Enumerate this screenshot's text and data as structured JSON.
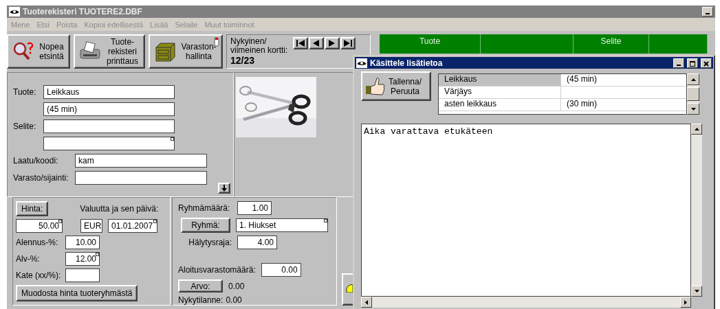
{
  "window": {
    "title": "Tuoterekisteri TUOTERE2.DBF"
  },
  "menu": [
    "Mene",
    "Etsi",
    "Poista",
    "Kopioi edellisestä",
    "Lisää",
    "Selaile",
    "Muut toiminnot"
  ],
  "toolbar": [
    {
      "kind": "search",
      "label": "Nopea\netsintä"
    },
    {
      "kind": "print",
      "label": "Tuote-\nrekisteri\nprinttaus"
    },
    {
      "kind": "stock",
      "label": "Varaston-\nhallinta"
    }
  ],
  "record_nav": {
    "label": "Nykyinen/\nviimeinen kortti:",
    "value": "12/23"
  },
  "grid": {
    "columns": [
      "Tuote",
      "Selite"
    ]
  },
  "product": {
    "name_fields": [
      {
        "label": "Tuote:",
        "value": "Leikkaus",
        "marked": false
      },
      {
        "value": "(45 min)",
        "marked": false
      },
      {
        "label": "Selite:",
        "marked": false
      },
      {
        "marked": true
      }
    ],
    "code_fields": [
      {
        "label": "Laatu/koodi:",
        "value": "kam",
        "marked": false
      },
      {
        "label": "Varasto/sijainti:",
        "marked": false
      }
    ]
  },
  "price": {
    "button": "Hinta:",
    "currency_label": "Valuutta ja sen päivä:",
    "price": {
      "value": "50.00",
      "marked": true
    },
    "currency": {
      "value": "EUR",
      "marked": false
    },
    "date": {
      "value": "01.01.2007",
      "marked": true
    },
    "fields": [
      {
        "label": "Alennus-%:",
        "value": "10.00",
        "marked": false
      },
      {
        "label": "Alv-%:",
        "value": "12.00",
        "marked": true
      },
      {
        "label": "Kate (xx/%):",
        "marked": false
      }
    ],
    "action": "Muodosta hinta tuoteryhmästä"
  },
  "group": {
    "quantity_label": "Ryhmämäärä:",
    "quantity": "1.00",
    "button": "Ryhmä:",
    "group": {
      "value": "1. Hiukset",
      "marked": true
    },
    "alert_label": "Hälytysraja:",
    "alert": "4.00",
    "start_label": "Aloitusvarastomäärä:",
    "start": "0.00",
    "value_button": "Arvo:",
    "value": "0.00",
    "current_label": "Nykytilanne:",
    "current": "0.00"
  },
  "dialog": {
    "title": "Käsittele lisätietoa",
    "button": "Tallenna/\nPeruuta",
    "rows": [
      {
        "name": "Leikkaus",
        "duration": "(45 min)",
        "selected": true
      },
      {
        "name": "Värjäys",
        "selected": false
      },
      {
        "name": "asten leikkaus",
        "duration": "(30 min)",
        "selected": false
      }
    ],
    "notes": "Aika varattava etukäteen"
  }
}
